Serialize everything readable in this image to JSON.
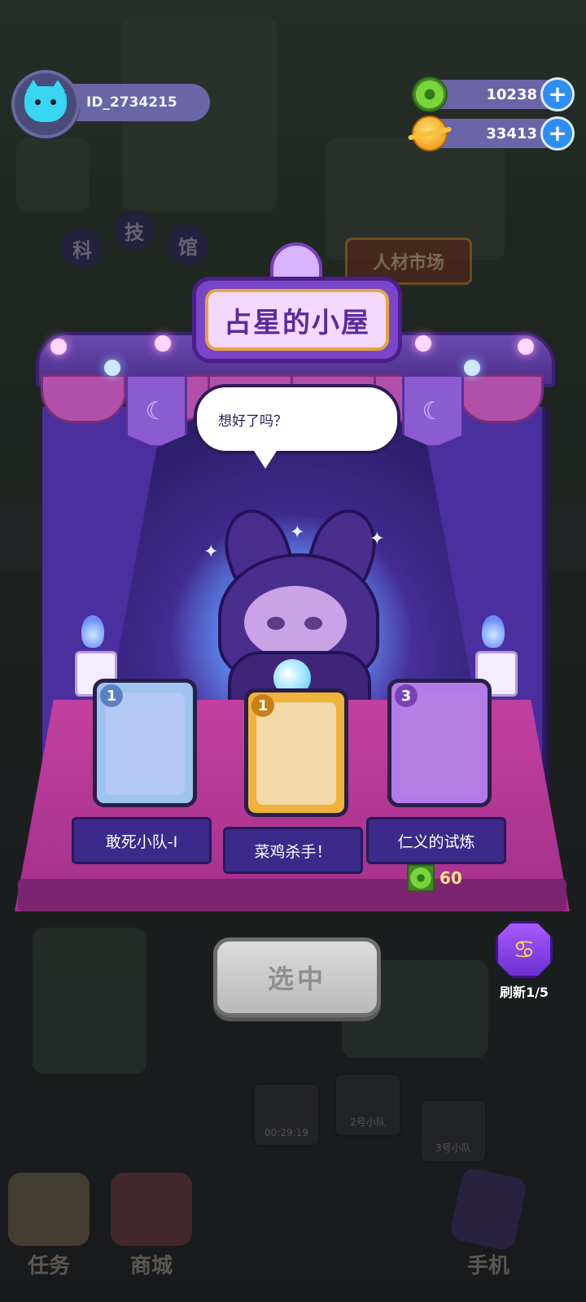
{
  "player": {
    "id_text": "ID_2734215"
  },
  "currencies": [
    {
      "icon": "donut-coin-icon",
      "value": "10238"
    },
    {
      "icon": "planet-coin-icon",
      "value": "33413"
    }
  ],
  "booth": {
    "title": "占星的小屋",
    "speech": "想好了吗？"
  },
  "cards": [
    {
      "level": "1",
      "name": "敢死小队-I",
      "frame_color": "#9ec3ef",
      "art_color": "#b3c8f4"
    },
    {
      "level": "1",
      "name": "菜鸡杀手！",
      "frame_color": "#f1b23a",
      "art_color": "#f2d7a8"
    },
    {
      "level": "3",
      "name": "仁义的试炼",
      "frame_color": "#b27be8",
      "art_color": "#b57fe6"
    }
  ],
  "cost": {
    "icon": "donut-coin-icon",
    "value": "60"
  },
  "select_button": {
    "label": "选中"
  },
  "refresh": {
    "label": "刷新1/5",
    "icon": "cancer-zodiac-icon"
  },
  "background": {
    "signs": [
      "科",
      "技",
      "馆",
      "人材市场"
    ],
    "squads": [
      "00:29:19",
      "2号小队",
      "3号小队"
    ],
    "nav": [
      {
        "label": "任务",
        "icon": "quest-book-icon"
      },
      {
        "label": "商城",
        "icon": "shop-icon"
      },
      {
        "label": "手机",
        "icon": "phone-icon"
      }
    ]
  }
}
